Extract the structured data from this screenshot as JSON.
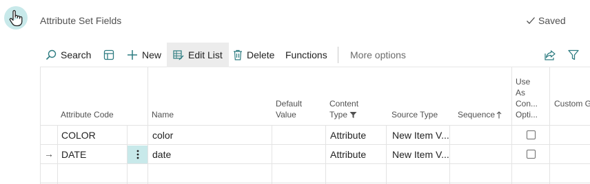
{
  "header": {
    "title": "Attribute Set Fields",
    "saved_label": "Saved"
  },
  "toolbar": {
    "search_label": "Search",
    "new_label": "New",
    "edit_list_label": "Edit List",
    "delete_label": "Delete",
    "functions_label": "Functions",
    "more_options_label": "More options"
  },
  "columns": {
    "attribute_code": "Attribute Code",
    "name": "Name",
    "default_value_1": "Default",
    "default_value_2": "Value",
    "content_type_1": "Content",
    "content_type_2": "Type",
    "source_type": "Source Type",
    "sequence": "Sequence",
    "use_as_1": "Use",
    "use_as_2": "As",
    "use_as_3": "Con...",
    "use_as_4": "Opti...",
    "custom": "Custom G"
  },
  "rows": [
    {
      "code": "COLOR",
      "name": "color",
      "content_type": "Attribute",
      "source_type": "New Item V...",
      "checked": false
    },
    {
      "code": "DATE",
      "name": "date",
      "content_type": "Attribute",
      "source_type": "New Item V...",
      "checked": false
    }
  ],
  "colors": {
    "accent": "#c8e9ea",
    "line": "#e3e3e3"
  },
  "icons": [
    "pointer-hand-icon",
    "checkmark-icon",
    "search-icon",
    "view-layout-icon",
    "plus-icon",
    "edit-list-icon",
    "trash-icon",
    "share-icon",
    "filter-icon",
    "row-arrow-icon",
    "kebab-icon"
  ]
}
